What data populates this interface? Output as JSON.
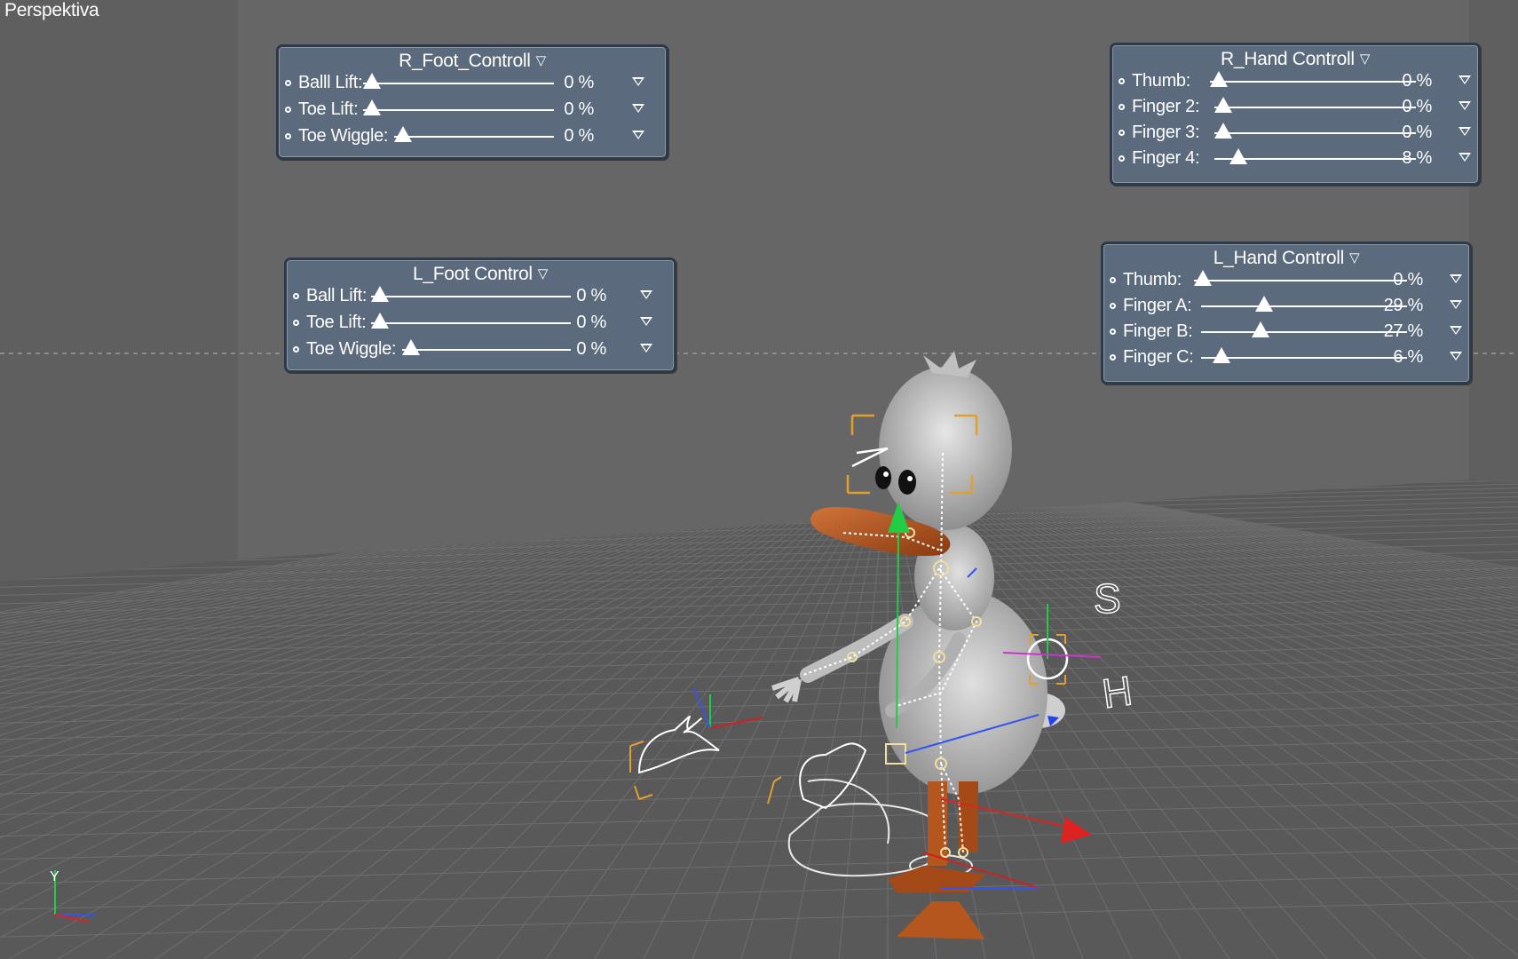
{
  "viewport": {
    "label": "Perspektiva"
  },
  "panels": [
    {
      "title": "R_Foot_Controll",
      "rows": [
        {
          "label": "Balll Lift:",
          "value": "0 %",
          "fraction": 0.0
        },
        {
          "label": "Toe Lift:",
          "value": "0 %",
          "fraction": 0.0
        },
        {
          "label": "Toe Wiggle:",
          "value": "0 %",
          "fraction": 0.0
        }
      ]
    },
    {
      "title": "L_Foot Control",
      "rows": [
        {
          "label": "Ball Lift:",
          "value": "0 %",
          "fraction": 0.0
        },
        {
          "label": "Toe Lift:",
          "value": "0 %",
          "fraction": 0.0
        },
        {
          "label": "Toe Wiggle:",
          "value": "0 %",
          "fraction": 0.0
        }
      ]
    },
    {
      "title": "R_Hand Controll",
      "rows": [
        {
          "label": "Thumb:",
          "value": "0 %",
          "fraction": 0.0
        },
        {
          "label": "Finger 2:",
          "value": "0 %",
          "fraction": 0.0
        },
        {
          "label": "Finger 3:",
          "value": "0 %",
          "fraction": 0.0
        },
        {
          "label": "Finger 4:",
          "value": "8 %",
          "fraction": 0.08
        }
      ]
    },
    {
      "title": "L_Hand Controll",
      "rows": [
        {
          "label": "Thumb:",
          "value": "0 %",
          "fraction": 0.0
        },
        {
          "label": "Finger A:",
          "value": "29 %",
          "fraction": 0.29
        },
        {
          "label": "Finger B:",
          "value": "27 %",
          "fraction": 0.27
        },
        {
          "label": "Finger C:",
          "value": "6 %",
          "fraction": 0.06
        }
      ]
    }
  ],
  "scene": {
    "colors": {
      "floor": "#5c5c5c",
      "wall": "#646464",
      "grid": "#707070",
      "duck_body": "#c9c9c9",
      "beak": "#b5561e",
      "bone": "#ffffff",
      "control": "#e0a030"
    },
    "handle_labels": {
      "s": "S",
      "h": "H"
    },
    "axis_labels": {
      "y": "Y"
    }
  }
}
